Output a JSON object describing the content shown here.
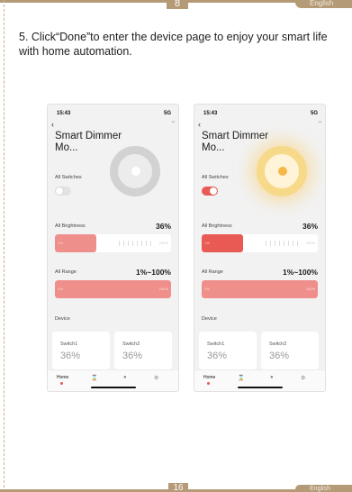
{
  "header": {
    "page_number": "8",
    "language": "English"
  },
  "footer": {
    "page_number": "16",
    "language": "English"
  },
  "instruction": "5. Click“Done”to enter the device page to enjoy your smart life with home automation.",
  "phones": [
    {
      "time": "15:43",
      "signal": "5G",
      "title": "Smart Dimmer Mo...",
      "all_switches": "All Switches",
      "toggle_on": false,
      "brightness_label": "All Brightness",
      "brightness_value": "36%",
      "brightness_level": 36,
      "range_label": "All Range",
      "range_value": "1%~100%",
      "slider_min": "1%",
      "slider_max": "100%",
      "device_label": "Device",
      "devices": [
        {
          "name": "Switch1",
          "value": "36%"
        },
        {
          "name": "Switch2",
          "value": "36%"
        }
      ],
      "tabs": {
        "home": "Home"
      }
    },
    {
      "time": "15:43",
      "signal": "5G",
      "title": "Smart Dimmer Mo...",
      "all_switches": "All Switches",
      "toggle_on": true,
      "brightness_label": "All Brightness",
      "brightness_value": "36%",
      "brightness_level": 36,
      "range_label": "All Range",
      "range_value": "1%~100%",
      "slider_min": "1%",
      "slider_max": "100%",
      "device_label": "Device",
      "devices": [
        {
          "name": "Switch1",
          "value": "36%"
        },
        {
          "name": "Switch2",
          "value": "36%"
        }
      ],
      "tabs": {
        "home": "Home"
      }
    }
  ],
  "colors": {
    "accent_gold": "#b49a76",
    "toggle_on": "#e85a55",
    "slider_fill": "#ef8f8b",
    "lamp_glow": "#f7d98a"
  },
  "icons": {
    "back": "chevron-left-icon",
    "more": "more-icon",
    "timer": "hourglass-icon",
    "scene": "scene-icon",
    "settings": "gear-icon"
  }
}
